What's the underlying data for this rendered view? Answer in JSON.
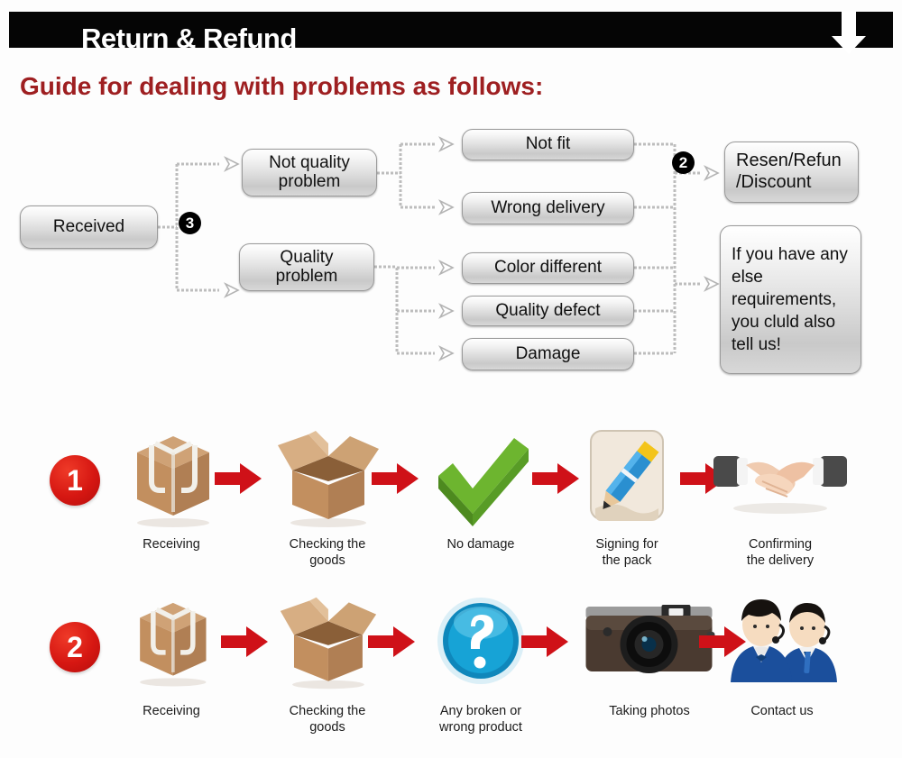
{
  "header": {
    "title": "Return & Refund",
    "down_arrow_icon": "down-arrow-icon",
    "bar_color": "#050505",
    "title_color": "#ffffff"
  },
  "guide": {
    "heading": "Guide for dealing with problems as follows:",
    "heading_color": "#9e1f21"
  },
  "flowchart": {
    "boxes": {
      "received": "Received",
      "not_quality_problem": "Not quality\nproblem",
      "quality_problem": "Quality\nproblem",
      "not_fit": "Not fit",
      "wrong_delivery": "Wrong delivery",
      "color_different": "Color different",
      "quality_defect": "Quality defect",
      "damage": "Damage",
      "resend_refund_discount": "Resen/Refun\n/Discount",
      "any_else_requirements": "If you have any else requirements, you cluld also tell us!"
    },
    "markers": {
      "marker_three": "3",
      "marker_two": "2"
    }
  },
  "steps": {
    "row1": {
      "number": "1",
      "cells": [
        {
          "icon": "sealed-box-icon",
          "label": "Receiving"
        },
        {
          "icon": "open-box-icon",
          "label": "Checking the\ngoods"
        },
        {
          "icon": "green-check-icon",
          "label": "No damage"
        },
        {
          "icon": "pencil-signing-icon",
          "label": "Signing for\nthe pack"
        },
        {
          "icon": "handshake-icon",
          "label": "Confirming\nthe delivery"
        }
      ]
    },
    "row2": {
      "number": "2",
      "cells": [
        {
          "icon": "sealed-box-icon",
          "label": "Receiving"
        },
        {
          "icon": "open-box-icon",
          "label": "Checking the\ngoods"
        },
        {
          "icon": "blue-question-icon",
          "label": "Any broken or\nwrong product"
        },
        {
          "icon": "camera-icon",
          "label": "Taking photos"
        },
        {
          "icon": "support-agents-icon",
          "label": "Contact us"
        }
      ]
    },
    "arrow_icon": "red-right-arrow-icon",
    "arrow_color": "#cf1118"
  },
  "colors": {
    "background": "#fdfdfd",
    "box_border": "#9a9a9a",
    "flow_line": "#b9b9b9",
    "badge_black": "#000000",
    "step_badge_red": "#d61712"
  }
}
